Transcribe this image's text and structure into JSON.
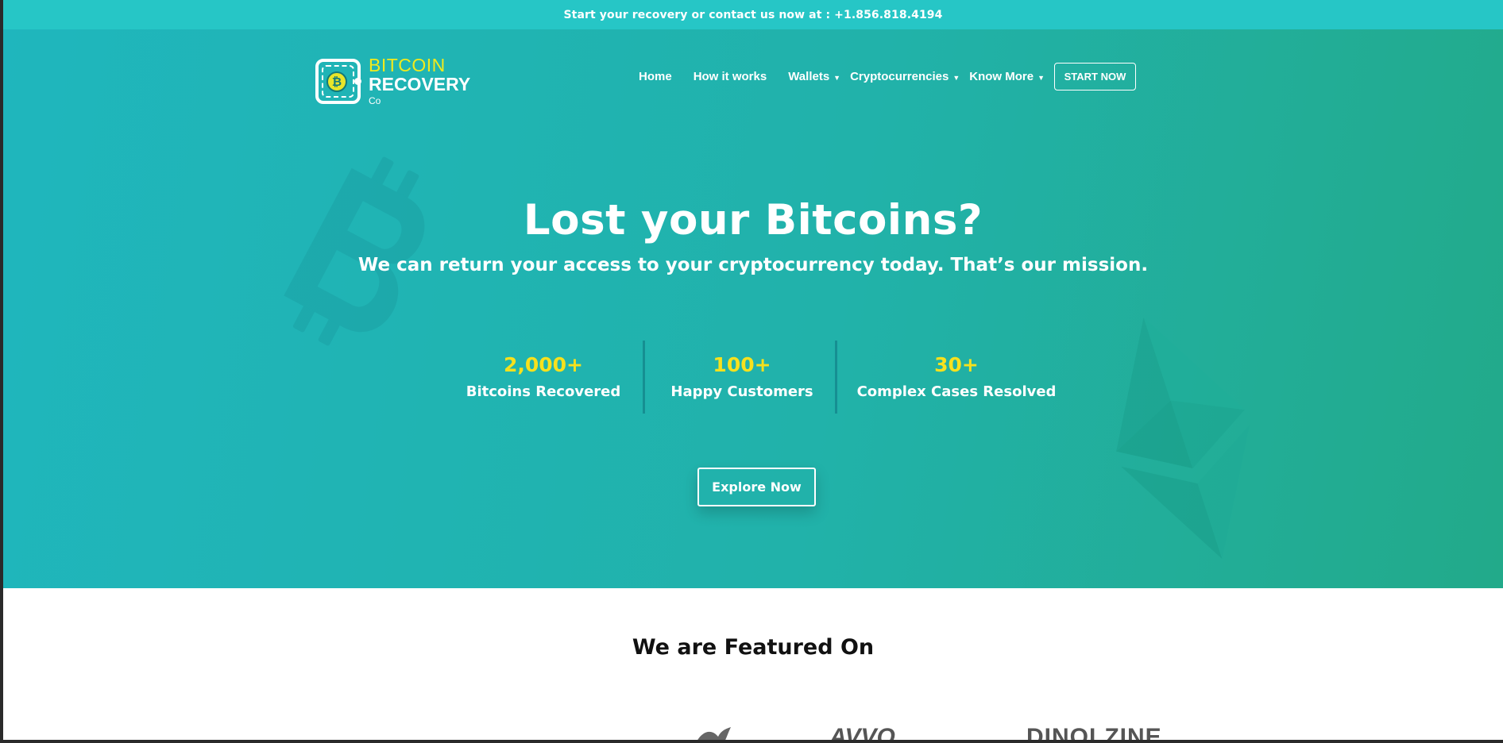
{
  "topbar": {
    "text": "Start your recovery or contact us now at : +1.856.818.4194"
  },
  "logo": {
    "line1": "BITCOIN",
    "line2": "RECOVERY",
    "line3": "Co",
    "coin_symbol": "₿"
  },
  "nav": {
    "items": [
      {
        "label": "Home",
        "has_dropdown": false
      },
      {
        "label": "How it works",
        "has_dropdown": false
      },
      {
        "label": "Wallets",
        "has_dropdown": true
      },
      {
        "label": "Cryptocurrencies",
        "has_dropdown": true
      },
      {
        "label": "Know More",
        "has_dropdown": true
      }
    ],
    "cta": "START NOW",
    "caret": "▼"
  },
  "hero": {
    "title": "Lost your Bitcoins?",
    "subtitle": "We can return your access to your cryptocurrency today. That’s our mission.",
    "stats": [
      {
        "value": "2,000+",
        "label": "Bitcoins Recovered"
      },
      {
        "value": "100+",
        "label": "Happy Customers"
      },
      {
        "value": "30+",
        "label": "Complex Cases Resolved"
      }
    ],
    "button": "Explore Now"
  },
  "featured": {
    "title": "We are Featured On",
    "partners": [
      "AVVO",
      "DINOLZINE"
    ]
  },
  "colors": {
    "topbar_bg": "#26c6c6",
    "hero_start": "#1fb6bd",
    "hero_end": "#22aa8a",
    "stat_value": "#f7e11d",
    "logo_accent": "#f2ea1c"
  },
  "icons": {
    "bitcoin_watermark": "bitcoin-logo-icon",
    "ethereum_watermark": "ethereum-logo-icon",
    "wallet_logo": "wallet-icon",
    "dropdown": "chevron-down-icon"
  }
}
